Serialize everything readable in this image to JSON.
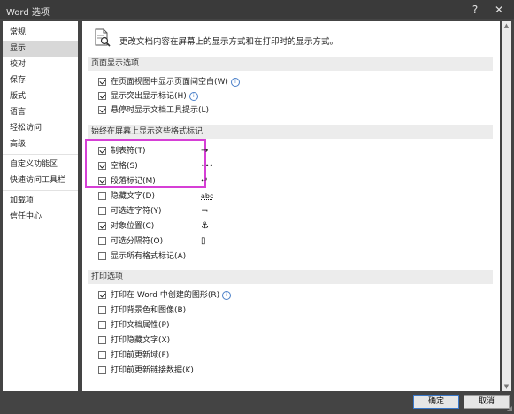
{
  "window": {
    "title": "Word 选项",
    "help": "?",
    "close": "✕"
  },
  "sidebar": {
    "items": [
      {
        "label": "常规"
      },
      {
        "label": "显示"
      },
      {
        "label": "校对"
      },
      {
        "label": "保存"
      },
      {
        "label": "版式"
      },
      {
        "label": "语言"
      },
      {
        "label": "轻松访问"
      },
      {
        "label": "高级"
      },
      {
        "label": "自定义功能区"
      },
      {
        "label": "快速访问工具栏"
      },
      {
        "label": "加载项"
      },
      {
        "label": "信任中心"
      }
    ],
    "selected": "显示"
  },
  "header": {
    "text": "更改文档内容在屏幕上的显示方式和在打印时的显示方式。",
    "icon": "doc-magnifier-icon"
  },
  "sections": {
    "page_display": {
      "title": "页面显示选项",
      "options": [
        {
          "label": "在页面视图中显示页面间空白(W)",
          "checked": true,
          "info": true
        },
        {
          "label": "显示突出显示标记(H)",
          "checked": true,
          "info": true
        },
        {
          "label": "悬停时显示文档工具提示(L)",
          "checked": true,
          "info": false
        }
      ]
    },
    "format_marks": {
      "title": "始终在屏幕上显示这些格式标记",
      "options": [
        {
          "label": "制表符(T)",
          "checked": true,
          "symbol": "→"
        },
        {
          "label": "空格(S)",
          "checked": true,
          "symbol": "•••"
        },
        {
          "label": "段落标记(M)",
          "checked": true,
          "symbol": "↵"
        },
        {
          "label": "隐藏文字(D)",
          "checked": false,
          "symbol": "abc"
        },
        {
          "label": "可选连字符(Y)",
          "checked": false,
          "symbol": "¬"
        },
        {
          "label": "对象位置(C)",
          "checked": true,
          "symbol": "⚓"
        },
        {
          "label": "可选分隔符(O)",
          "checked": false,
          "symbol": "▯"
        },
        {
          "label": "显示所有格式标记(A)",
          "checked": false,
          "symbol": ""
        }
      ]
    },
    "print": {
      "title": "打印选项",
      "options": [
        {
          "label": "打印在 Word 中创建的图形(R)",
          "checked": true,
          "info": true
        },
        {
          "label": "打印背景色和图像(B)",
          "checked": false,
          "info": false
        },
        {
          "label": "打印文档属性(P)",
          "checked": false,
          "info": false
        },
        {
          "label": "打印隐藏文字(X)",
          "checked": false,
          "info": false
        },
        {
          "label": "打印前更新域(F)",
          "checked": false,
          "info": false
        },
        {
          "label": "打印前更新链接数据(K)",
          "checked": false,
          "info": false
        }
      ]
    }
  },
  "footer": {
    "ok": "确定",
    "cancel": "取消"
  },
  "colors": {
    "highlight": "#d63fd6",
    "selected_nav": "#d8d8d8",
    "section_bg": "#ececec"
  }
}
